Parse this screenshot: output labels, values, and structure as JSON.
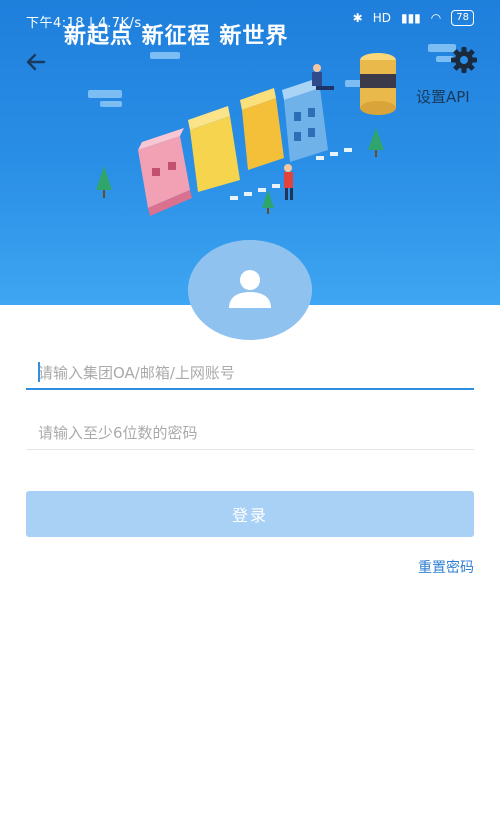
{
  "status_bar": {
    "time_text": "下午4:18 | 4.7K/s",
    "battery": "78",
    "network": "HD"
  },
  "banner": {
    "slogan": "新起点 新征程 新世界"
  },
  "header": {
    "settings_label": "设置API"
  },
  "form": {
    "account_placeholder": "请输入集团OA/邮箱/上网账号",
    "password_placeholder": "请输入至少6位数的密码",
    "login_label": "登录",
    "reset_label": "重置密码"
  },
  "colors": {
    "banner_blue": "#2a8fe6",
    "button_disabled": "#a9d1f5",
    "link_blue": "#2f7fd1"
  }
}
